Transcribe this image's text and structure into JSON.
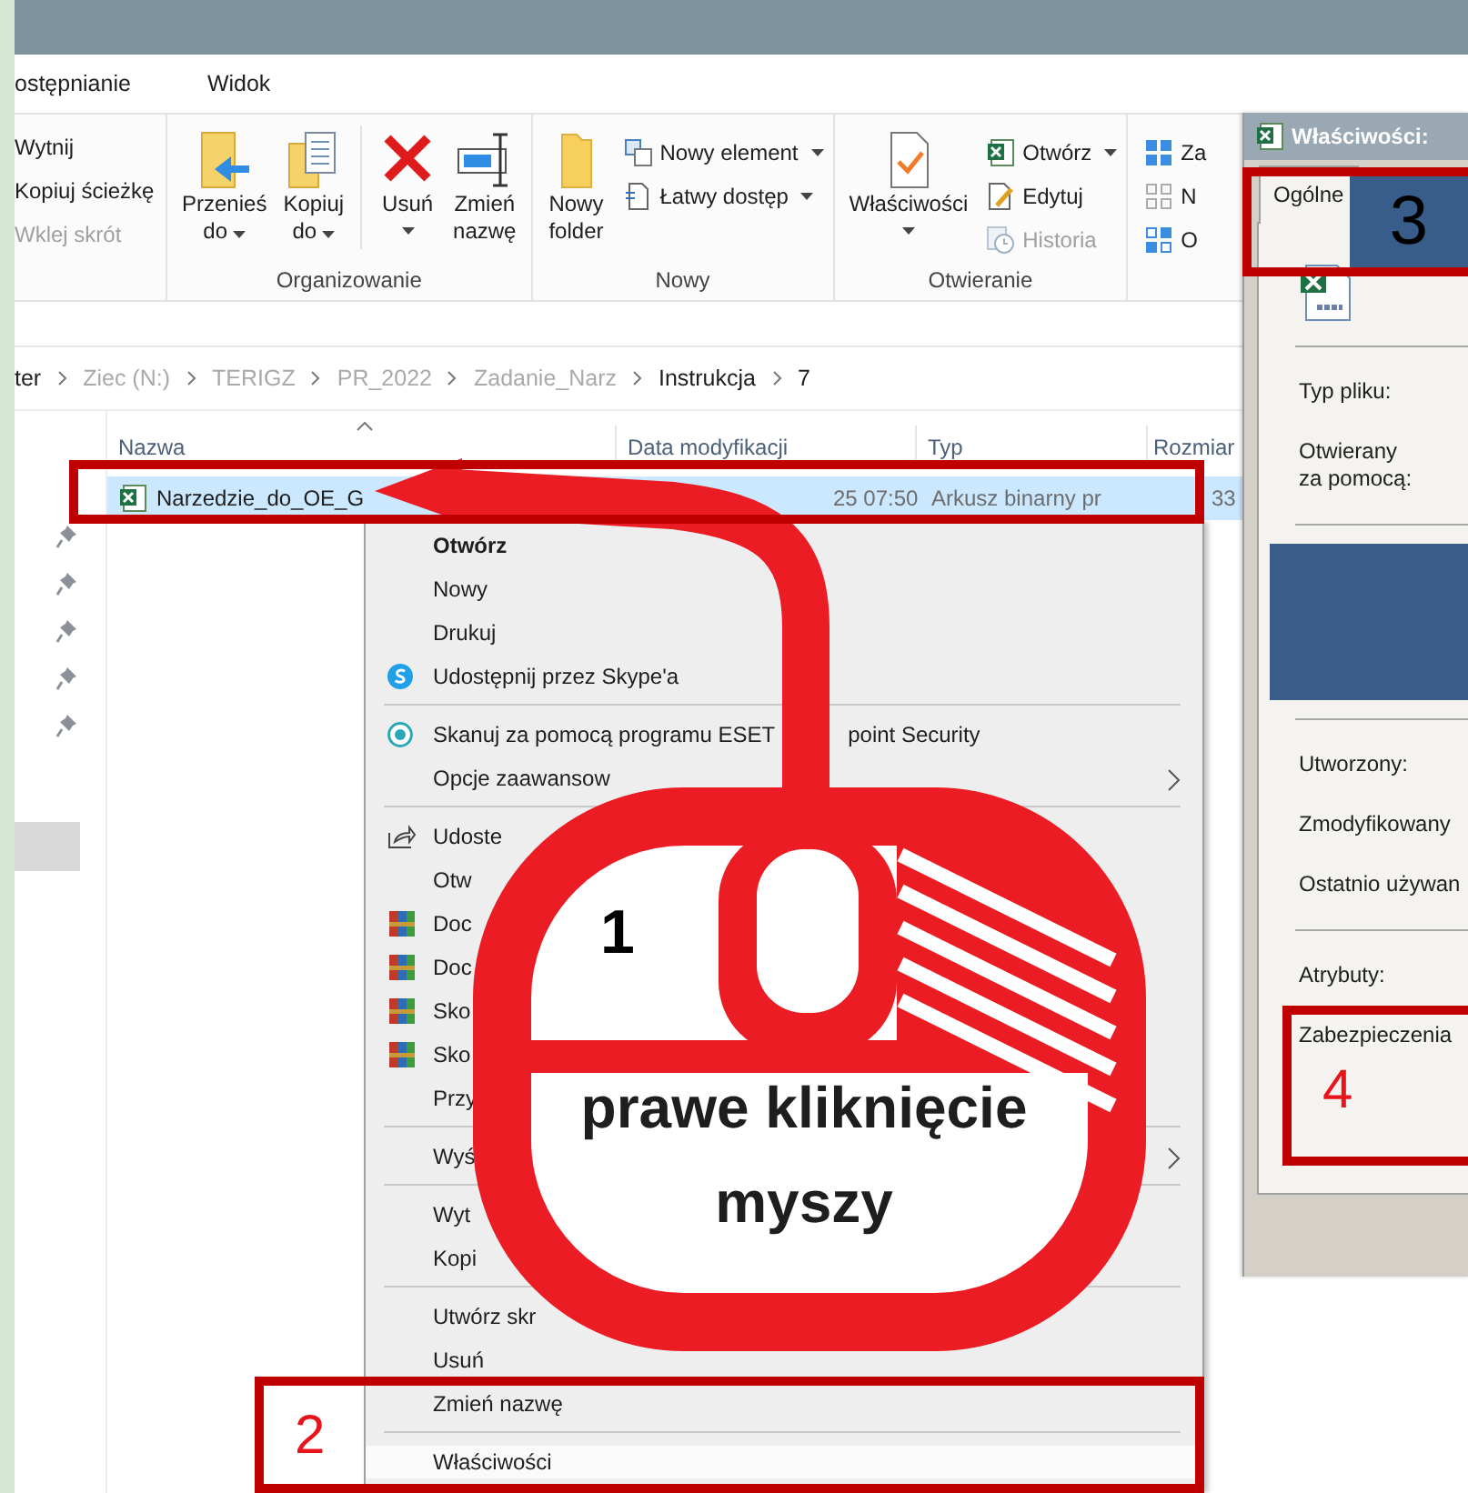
{
  "ribbon_tabs": [
    {
      "label": "ostępnianie",
      "selected": false
    },
    {
      "label": "Widok",
      "selected": false
    }
  ],
  "clipboard": [
    {
      "label": "Wytnij",
      "disabled": false
    },
    {
      "label": "Kopiuj ścieżkę",
      "disabled": false
    },
    {
      "label": "Wklej skrót",
      "disabled": true
    }
  ],
  "ribbon_groups": [
    {
      "title": "Organizowanie",
      "buttons": [
        {
          "lines": [
            "Przenieś",
            "do"
          ],
          "dropdown": true
        },
        {
          "lines": [
            "Kopiuj",
            "do"
          ],
          "dropdown": true
        },
        {
          "lines": [
            "Usuń"
          ],
          "dropdown": true
        },
        {
          "lines": [
            "Zmień",
            "nazwę"
          ],
          "dropdown": false
        }
      ]
    },
    {
      "title": "Nowy",
      "buttons": [
        {
          "lines": [
            "Nowy",
            "folder"
          ],
          "dropdown": false
        }
      ],
      "small_buttons": [
        {
          "label": "Nowy element",
          "dropdown": true,
          "disabled": false
        },
        {
          "label": "Łatwy dostęp",
          "dropdown": true,
          "disabled": false
        }
      ]
    },
    {
      "title": "Otwieranie",
      "buttons": [
        {
          "lines": [
            "Właściwości"
          ],
          "dropdown": true
        }
      ],
      "small_buttons": [
        {
          "label": "Otwórz",
          "dropdown": true,
          "disabled": false
        },
        {
          "label": "Edytuj",
          "dropdown": false,
          "disabled": false
        },
        {
          "label": "Historia",
          "dropdown": false,
          "disabled": true
        }
      ]
    }
  ],
  "partial_group": [
    {
      "label": "Za"
    },
    {
      "label": "N"
    },
    {
      "label": "O"
    }
  ],
  "breadcrumb": [
    {
      "label": "ter",
      "faded": false
    },
    {
      "label": "Ziec (N:)",
      "faded": true
    },
    {
      "label": "TERIGZ",
      "faded": true
    },
    {
      "label": "PR_2022",
      "faded": true
    },
    {
      "label": "Zadanie_Narz",
      "faded": true
    },
    {
      "label": "Instrukcja",
      "faded": false
    },
    {
      "label": "7",
      "faded": false
    }
  ],
  "columns": [
    "Nazwa",
    "Data modyfikacji",
    "Typ",
    "Rozmiar"
  ],
  "files": [
    {
      "name": "Narzedzie_do_OE_G",
      "modified": "25 07:50",
      "type": "Arkusz binarny pr",
      "size": "33",
      "selected": true
    }
  ],
  "context_menu": [
    {
      "kind": "item",
      "label": "Otwórz",
      "default": true,
      "submenu": false,
      "highlighted": false
    },
    {
      "kind": "item",
      "label": "Nowy",
      "default": false,
      "submenu": false,
      "highlighted": false
    },
    {
      "kind": "item",
      "label": "Drukuj",
      "default": false,
      "submenu": false,
      "highlighted": false
    },
    {
      "kind": "skype",
      "label": "Udostępnij przez Skype'a",
      "default": false,
      "submenu": false,
      "highlighted": false
    },
    {
      "kind": "separator"
    },
    {
      "kind": "eset",
      "label": "Skanuj za pomocą programu ESET",
      "tail": "point Security",
      "default": false,
      "submenu": false,
      "highlighted": false
    },
    {
      "kind": "item",
      "label": "Opcje zaawansow",
      "default": false,
      "submenu": true,
      "highlighted": false
    },
    {
      "kind": "separator"
    },
    {
      "kind": "share",
      "label": "Udoste",
      "default": false,
      "submenu": false,
      "highlighted": false
    },
    {
      "kind": "item",
      "label": "Otw",
      "default": false,
      "submenu": false,
      "highlighted": false
    },
    {
      "kind": "archive",
      "label": "Doc",
      "default": false,
      "submenu": false,
      "highlighted": false
    },
    {
      "kind": "archive",
      "label": "Doc",
      "default": false,
      "submenu": false,
      "highlighted": false
    },
    {
      "kind": "archive",
      "label": "Sko",
      "default": false,
      "submenu": false,
      "highlighted": false
    },
    {
      "kind": "archive",
      "label": "Sko",
      "default": false,
      "submenu": false,
      "highlighted": false
    },
    {
      "kind": "item",
      "label": "Przy",
      "default": false,
      "submenu": false,
      "highlighted": false
    },
    {
      "kind": "separator"
    },
    {
      "kind": "item",
      "label": "Wyś",
      "default": false,
      "submenu": true,
      "highlighted": false
    },
    {
      "kind": "separator"
    },
    {
      "kind": "item",
      "label": "Wyt",
      "default": false,
      "submenu": false,
      "highlighted": false
    },
    {
      "kind": "item",
      "label": "Kopi",
      "default": false,
      "submenu": false,
      "highlighted": false
    },
    {
      "kind": "separator"
    },
    {
      "kind": "item",
      "label": "Utwórz skr",
      "default": false,
      "submenu": false,
      "highlighted": false
    },
    {
      "kind": "item",
      "label": "Usuń",
      "default": false,
      "submenu": false,
      "highlighted": false
    },
    {
      "kind": "item",
      "label": "Zmień nazwę",
      "default": false,
      "submenu": false,
      "highlighted": false
    },
    {
      "kind": "separator"
    },
    {
      "kind": "item",
      "label": "Właściwości",
      "default": false,
      "submenu": false,
      "highlighted": true
    }
  ],
  "properties_dialog": {
    "title": "Właściwości:",
    "tabs": [
      {
        "label": "Ogólne",
        "selected": true
      }
    ],
    "sections": [
      {
        "kind": "fields",
        "fields": [
          {
            "lines": [
              "Typ pliku:"
            ]
          },
          {
            "lines": [
              "Otwierany",
              "za pomocą:"
            ]
          }
        ]
      },
      {
        "kind": "redacted"
      },
      {
        "kind": "fields",
        "fields": [
          {
            "lines": [
              "Utworzony:"
            ]
          },
          {
            "lines": [
              "Zmodyfikowany"
            ]
          },
          {
            "lines": [
              "Ostatnio używan"
            ]
          }
        ]
      },
      {
        "kind": "fields",
        "fields": [
          {
            "lines": [
              "Atrybuty:"
            ]
          },
          {
            "lines": [
              "Zabezpieczenia"
            ]
          }
        ]
      }
    ]
  },
  "annotations": {
    "callouts": [
      {
        "label": "1",
        "color": "#000000"
      },
      {
        "label": "2",
        "color": "#e8141c"
      },
      {
        "label": "3",
        "color": "#000000"
      },
      {
        "label": "4",
        "color": "#e8141c"
      }
    ],
    "mouse_caption": [
      "prawe kliknięcie",
      "myszy"
    ]
  }
}
